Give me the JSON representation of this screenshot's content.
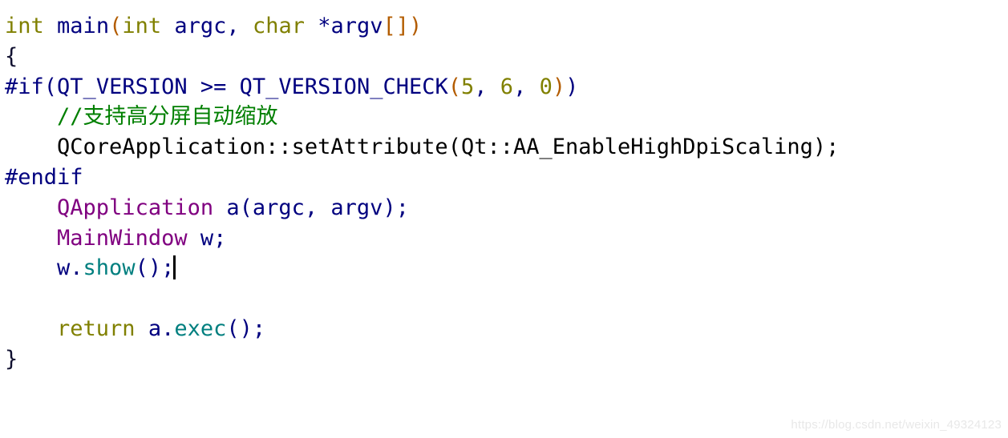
{
  "editor": {
    "language": "C++",
    "background_color": "#ffffff",
    "font_size_px": 27,
    "line_height_px": 37.8,
    "cursor": {
      "visible": true,
      "line_index": 8,
      "after_text": "w.show();"
    },
    "colors": {
      "keyword": "#808000",
      "identifier": "#00007f",
      "preprocessor": "#00007f",
      "plain": "#000000",
      "class_name": "#800080",
      "member_function": "#007f7f",
      "comment": "#007f00",
      "number": "#808000",
      "matched_bracket": "#b35c00",
      "brace": "#101030",
      "background": "#ffffff",
      "watermark": "#e8e8e8"
    },
    "lines": [
      {
        "id": "line-1",
        "text": "int main(int argc, char *argv[])",
        "tokens": [
          {
            "t": "int",
            "c": "keyword"
          },
          {
            "t": " ",
            "c": "plain"
          },
          {
            "t": "main",
            "c": "ident"
          },
          {
            "t": "(",
            "c": "bracket"
          },
          {
            "t": "int",
            "c": "keyword"
          },
          {
            "t": " ",
            "c": "plain"
          },
          {
            "t": "argc",
            "c": "ident"
          },
          {
            "t": ",",
            "c": "ident"
          },
          {
            "t": " ",
            "c": "plain"
          },
          {
            "t": "char",
            "c": "keyword"
          },
          {
            "t": " ",
            "c": "plain"
          },
          {
            "t": "*argv",
            "c": "ident"
          },
          {
            "t": "[]",
            "c": "bracket"
          },
          {
            "t": ")",
            "c": "bracket"
          }
        ]
      },
      {
        "id": "line-2",
        "text": "{",
        "tokens": [
          {
            "t": "{",
            "c": "brace"
          }
        ]
      },
      {
        "id": "line-3",
        "text": "#if(QT_VERSION >= QT_VERSION_CHECK(5, 6, 0))",
        "tokens": [
          {
            "t": "#if",
            "c": "preproc"
          },
          {
            "t": "(",
            "c": "preproc"
          },
          {
            "t": "QT_VERSION",
            "c": "preproc"
          },
          {
            "t": " >= ",
            "c": "preproc"
          },
          {
            "t": "QT_VERSION_CHECK",
            "c": "preproc"
          },
          {
            "t": "(",
            "c": "bracket"
          },
          {
            "t": "5",
            "c": "number"
          },
          {
            "t": ",",
            "c": "preproc"
          },
          {
            "t": " ",
            "c": "plain"
          },
          {
            "t": "6",
            "c": "number"
          },
          {
            "t": ",",
            "c": "preproc"
          },
          {
            "t": " ",
            "c": "plain"
          },
          {
            "t": "0",
            "c": "number"
          },
          {
            "t": ")",
            "c": "bracket"
          },
          {
            "t": ")",
            "c": "preproc"
          }
        ]
      },
      {
        "id": "line-4",
        "text": "    //支持高分屏自动缩放",
        "tokens": [
          {
            "t": "    ",
            "c": "plain"
          },
          {
            "t": "//支持高分屏自动缩放",
            "c": "comment"
          }
        ]
      },
      {
        "id": "line-5",
        "text": "    QCoreApplication::setAttribute(Qt::AA_EnableHighDpiScaling);",
        "tokens": [
          {
            "t": "    ",
            "c": "plain"
          },
          {
            "t": "QCoreApplication::setAttribute(Qt::AA_EnableHighDpiScaling);",
            "c": "plain"
          }
        ]
      },
      {
        "id": "line-6",
        "text": "#endif",
        "tokens": [
          {
            "t": "#endif",
            "c": "preproc"
          }
        ]
      },
      {
        "id": "line-7",
        "text": "    QApplication a(argc, argv);",
        "tokens": [
          {
            "t": "    ",
            "c": "plain"
          },
          {
            "t": "QApplication",
            "c": "class"
          },
          {
            "t": " ",
            "c": "plain"
          },
          {
            "t": "a(argc, argv);",
            "c": "ident"
          }
        ]
      },
      {
        "id": "line-8",
        "text": "    MainWindow w;",
        "tokens": [
          {
            "t": "    ",
            "c": "plain"
          },
          {
            "t": "MainWindow",
            "c": "class"
          },
          {
            "t": " ",
            "c": "plain"
          },
          {
            "t": "w;",
            "c": "ident"
          }
        ]
      },
      {
        "id": "line-9",
        "text": "    w.show();",
        "tokens": [
          {
            "t": "    ",
            "c": "plain"
          },
          {
            "t": "w.",
            "c": "ident"
          },
          {
            "t": "show",
            "c": "member"
          },
          {
            "t": "();",
            "c": "ident"
          }
        ],
        "cursor_after": true
      },
      {
        "id": "line-10",
        "text": "",
        "tokens": []
      },
      {
        "id": "line-11",
        "text": "    return a.exec();",
        "tokens": [
          {
            "t": "    ",
            "c": "plain"
          },
          {
            "t": "return",
            "c": "keyword"
          },
          {
            "t": " ",
            "c": "plain"
          },
          {
            "t": "a.",
            "c": "ident"
          },
          {
            "t": "exec",
            "c": "member"
          },
          {
            "t": "();",
            "c": "ident"
          }
        ]
      },
      {
        "id": "line-12",
        "text": "}",
        "tokens": [
          {
            "t": "}",
            "c": "brace"
          }
        ]
      }
    ]
  },
  "watermark": {
    "text": "https://blog.csdn.net/weixin_49324123"
  }
}
